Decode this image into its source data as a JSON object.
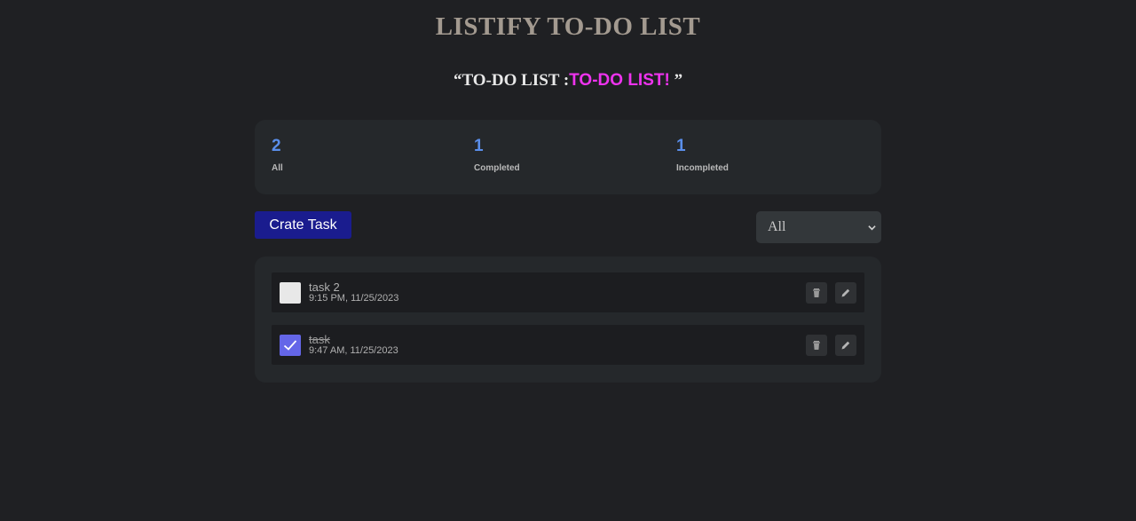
{
  "app": {
    "title": "LISTIFY TO-DO LIST"
  },
  "quote": {
    "open": "“TO-DO LIST :",
    "highlight": "TO-DO LIST!",
    "close": " ”"
  },
  "stats": [
    {
      "count": "2",
      "label": "All"
    },
    {
      "count": "1",
      "label": "Completed"
    },
    {
      "count": "1",
      "label": "Incompleted"
    }
  ],
  "toolbar": {
    "create_label": "Crate Task",
    "filter_value": "All"
  },
  "tasks": [
    {
      "title": "task 2",
      "time": "9:15 PM, 11/25/2023",
      "completed": false
    },
    {
      "title": "task",
      "time": "9:47 AM, 11/25/2023",
      "completed": true
    }
  ],
  "icons": {
    "delete": "trash-icon",
    "edit": "pencil-icon",
    "check": "check-icon",
    "filter": "chevron-down-icon"
  },
  "colors": {
    "background": "#1f2023",
    "card": "#25282b",
    "accent_count": "#5a8eea",
    "highlight": "#ee33ee",
    "create_button": "#1a1c8e",
    "checked_box": "#6466e8"
  }
}
